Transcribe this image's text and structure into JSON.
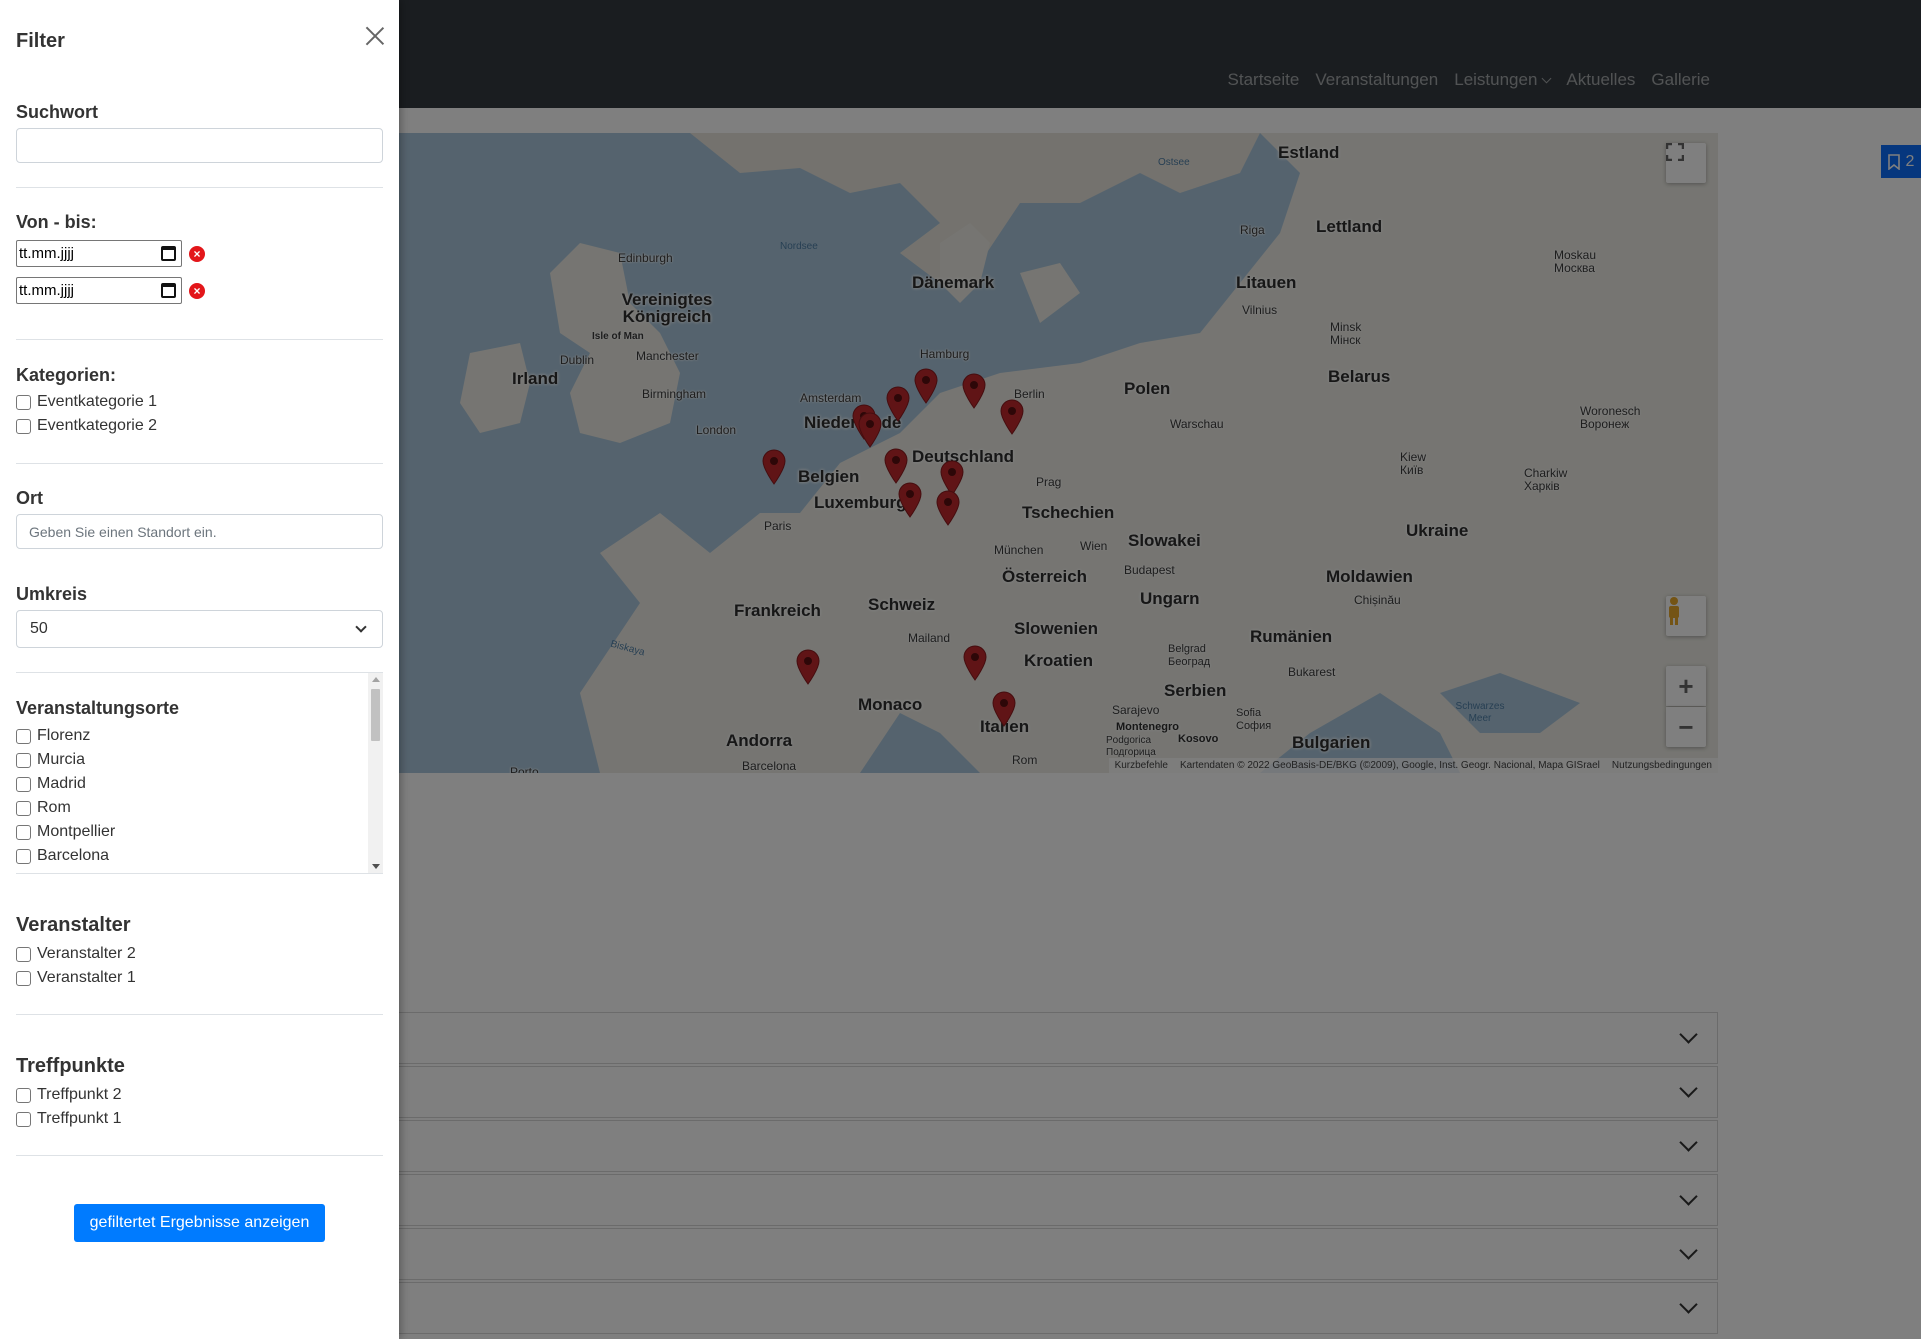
{
  "header": {
    "nav": [
      "Startseite",
      "Veranstaltungen",
      "Leistungen",
      "Aktuelles",
      "Gallerie"
    ]
  },
  "map": {
    "countries": [
      "Estland",
      "Lettland",
      "Dänemark",
      "Litauen",
      "Vereinigtes Königreich",
      "Irland",
      "Belarus",
      "Polen",
      "Niederlande",
      "Belgien",
      "Luxemburg",
      "Deutschland",
      "Tschechien",
      "Slowakei",
      "Ukraine",
      "Österreich",
      "Ungarn",
      "Moldawien",
      "Frankreich",
      "Schweiz",
      "Slowenien",
      "Rumänien",
      "Kroatien",
      "Serbien",
      "Monaco",
      "Andorra",
      "Bulgarien",
      "Italien",
      "Montenegro",
      "Kosovo"
    ],
    "cities": [
      "Riga",
      "Edinburgh",
      "Isle of Man",
      "Dublin",
      "Manchester",
      "Birmingham",
      "London",
      "Amsterdam",
      "Hamburg",
      "Berlin",
      "Warschau",
      "Minsk Мінск",
      "Vilnius",
      "Moskau Москва",
      "Woronesch Воронеж",
      "Kiew Київ",
      "Charkiw Харків",
      "Paris",
      "Prag",
      "München",
      "Wien",
      "Budapest",
      "Chișinău",
      "Mailand",
      "Belgrad Београд",
      "Bukarest",
      "Sarajevo",
      "Sofia София",
      "Podgorica Подгорица",
      "Barcelona",
      "Rom",
      "Porto"
    ],
    "seas": [
      "Ostsee",
      "Nordsee",
      "Biskaya",
      "Schwarzes Meer"
    ],
    "attribution": [
      "Kurzbefehle",
      "Kartendaten © 2022 GeoBasis-DE/BKG (©2009), Google, Inst. Geogr. Nacional, Mapa GISrael",
      "Nutzungsbedingungen"
    ],
    "zoom_in": "+",
    "zoom_out": "−"
  },
  "bookmark": {
    "count": "2"
  },
  "filter": {
    "title": "Filter",
    "suchwort": {
      "label": "Suchwort",
      "value": ""
    },
    "date": {
      "label": "Von - bis:",
      "from_placeholder": "tt.mm.jjjj",
      "to_placeholder": "tt.mm.jjjj"
    },
    "kategorien": {
      "label": "Kategorien:",
      "items": [
        "Eventkategorie 1",
        "Eventkategorie 2"
      ]
    },
    "ort": {
      "label": "Ort",
      "placeholder": "Geben Sie einen Standort ein."
    },
    "umkreis": {
      "label": "Umkreis",
      "value": "50"
    },
    "veranstaltungsorte": {
      "label": "Veranstaltungsorte",
      "items": [
        "Florenz",
        "Murcia",
        "Madrid",
        "Rom",
        "Montpellier",
        "Barcelona"
      ]
    },
    "veranstalter": {
      "label": "Veranstalter",
      "items": [
        "Veranstalter 2",
        "Veranstalter 1"
      ]
    },
    "treffpunkte": {
      "label": "Treffpunkte",
      "items": [
        "Treffpunkt 2",
        "Treffpunkt 1"
      ]
    },
    "submit": "gefiltertet Ergebnisse anzeigen"
  },
  "colors": {
    "accent": "#007bff",
    "header_bg": "#343a40",
    "pin": "#c0282d",
    "clear": "#e3161a"
  }
}
